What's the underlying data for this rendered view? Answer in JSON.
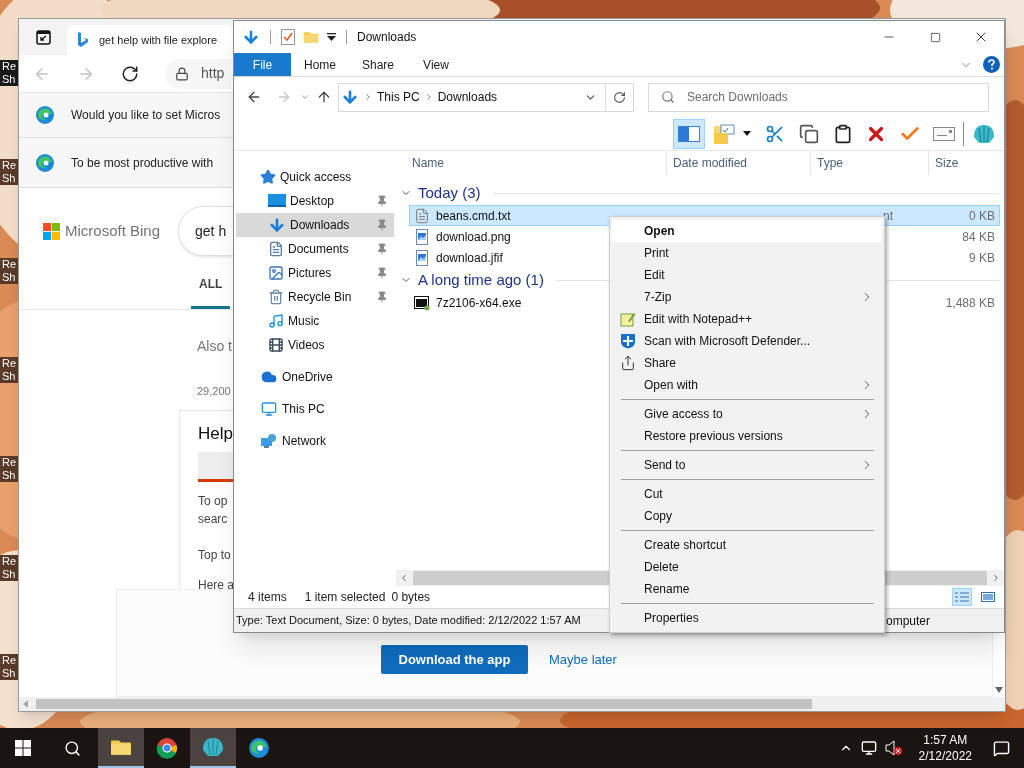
{
  "desktop": {
    "icons": [
      {
        "lines": [
          "Re",
          "Sh"
        ],
        "selected": true
      },
      {
        "lines": [
          "Re",
          "Sh"
        ],
        "selected": false
      },
      {
        "lines": [
          "Re",
          "Sh"
        ],
        "selected": false
      },
      {
        "lines": [
          "Re",
          "Sh"
        ],
        "selected": false
      },
      {
        "lines": [
          "Re",
          "Sh"
        ],
        "selected": false
      },
      {
        "lines": [
          "Re",
          "Sh"
        ],
        "selected": false
      },
      {
        "lines": [
          "Re",
          "Sh"
        ],
        "selected": false
      }
    ]
  },
  "browser": {
    "tab_title": "get help with file explore",
    "address": "http",
    "infobars": [
      {
        "text": "Would you like to set Micros"
      },
      {
        "text": "To be most productive with"
      }
    ],
    "logo": "Microsoft Bing",
    "query": "get h",
    "tabs": [
      {
        "label": "ALL",
        "selected": true
      }
    ],
    "also": "Also t",
    "count": "29,200",
    "card": {
      "title": "Help",
      "lines": [
        "To op",
        "searc"
      ],
      "top": "Top to",
      "here": "Here a"
    },
    "banner": {
      "button": "Download the app",
      "link": "Maybe later"
    }
  },
  "explorer": {
    "title": "Downloads",
    "ribbon_tabs": [
      {
        "label": "File",
        "selected": true
      },
      {
        "label": "Home",
        "selected": false
      },
      {
        "label": "Share",
        "selected": false
      },
      {
        "label": "View",
        "selected": false
      }
    ],
    "breadcrumb": [
      "This PC",
      "Downloads"
    ],
    "search": {
      "placeholder": "Search Downloads"
    },
    "nav": [
      {
        "label": "Quick access",
        "children": [
          {
            "label": "Desktop",
            "pinned": true,
            "selected": false
          },
          {
            "label": "Downloads",
            "pinned": true,
            "selected": true
          },
          {
            "label": "Documents",
            "pinned": true,
            "selected": false
          },
          {
            "label": "Pictures",
            "pinned": true,
            "selected": false
          },
          {
            "label": "Recycle Bin",
            "pinned": true,
            "selected": false
          },
          {
            "label": "Music",
            "pinned": false,
            "selected": false
          },
          {
            "label": "Videos",
            "pinned": false,
            "selected": false
          }
        ]
      },
      {
        "label": "OneDrive"
      },
      {
        "label": "This PC"
      },
      {
        "label": "Network"
      }
    ],
    "columns": [
      "Name",
      "Date modified",
      "Type",
      "Size"
    ],
    "groups": [
      {
        "label": "Today (3)",
        "expanded": true,
        "files": [
          {
            "name": "beans.cmd.txt",
            "type": "nt",
            "size": "0 KB",
            "selected": true
          },
          {
            "name": "download.png",
            "size": "84 KB",
            "selected": false
          },
          {
            "name": "download.jfif",
            "size": "9 KB",
            "selected": false
          }
        ]
      },
      {
        "label": "A long time ago (1)",
        "expanded": true,
        "files": [
          {
            "name": "7z2106-x64.exe",
            "size": "1,488 KB",
            "selected": false
          }
        ]
      }
    ],
    "status": {
      "count": "4 items",
      "selection": "1 item selected",
      "size": "0 bytes"
    },
    "details": {
      "text": "Type: Text Document, Size: 0 bytes, Date modified: 2/12/2022 1:57 AM",
      "tail": "omputer"
    }
  },
  "context_menu": {
    "groups": [
      [
        {
          "label": "Open",
          "default": true,
          "highlighted": true,
          "submenu": false
        },
        {
          "label": "Print",
          "default": false,
          "highlighted": false,
          "submenu": false
        },
        {
          "label": "Edit",
          "default": false,
          "highlighted": false,
          "submenu": false
        },
        {
          "label": "7-Zip",
          "default": false,
          "highlighted": false,
          "submenu": true
        },
        {
          "label": "Edit with Notepad++",
          "default": false,
          "highlighted": false,
          "submenu": false
        },
        {
          "label": "Scan with Microsoft Defender...",
          "default": false,
          "highlighted": false,
          "submenu": false
        },
        {
          "label": "Share",
          "default": false,
          "highlighted": false,
          "submenu": false
        },
        {
          "label": "Open with",
          "default": false,
          "highlighted": false,
          "submenu": true
        }
      ],
      [
        {
          "label": "Give access to",
          "default": false,
          "highlighted": false,
          "submenu": true
        },
        {
          "label": "Restore previous versions",
          "default": false,
          "highlighted": false,
          "submenu": false
        }
      ],
      [
        {
          "label": "Send to",
          "default": false,
          "highlighted": false,
          "submenu": true
        }
      ],
      [
        {
          "label": "Cut",
          "default": false,
          "highlighted": false,
          "submenu": false
        },
        {
          "label": "Copy",
          "default": false,
          "highlighted": false,
          "submenu": false
        }
      ],
      [
        {
          "label": "Create shortcut",
          "default": false,
          "highlighted": false,
          "submenu": false
        },
        {
          "label": "Delete",
          "default": false,
          "highlighted": false,
          "submenu": false
        },
        {
          "label": "Rename",
          "default": false,
          "highlighted": false,
          "submenu": false
        }
      ],
      [
        {
          "label": "Properties",
          "default": false,
          "highlighted": false,
          "submenu": false
        }
      ]
    ]
  },
  "taskbar": {
    "apps": [
      {
        "active": true
      },
      {
        "active": false
      },
      {
        "active": true
      },
      {
        "active": false
      }
    ],
    "time": "1:57 AM",
    "date": "2/12/2022"
  }
}
